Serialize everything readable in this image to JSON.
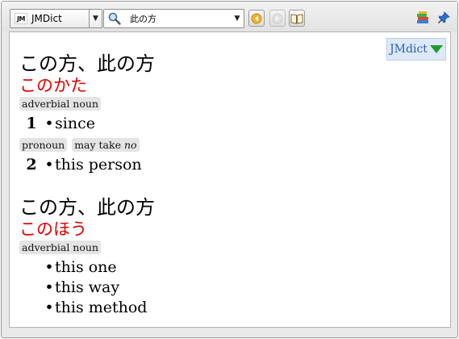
{
  "toolbar": {
    "dictionary": "JMDict",
    "search_value": "此の方",
    "logo_text": "JM"
  },
  "results": {
    "dict_badge": "JMdict",
    "entries": [
      {
        "headword": "この方、此の方",
        "reading": "このかた",
        "senses": [
          {
            "tags": [
              "adverbial noun"
            ],
            "num": "1",
            "gloss": "since"
          },
          {
            "tags": [
              "pronoun"
            ],
            "tag_prefix": "may take ",
            "tag_em": "no",
            "num": "2",
            "gloss": "this person"
          }
        ]
      },
      {
        "headword": "この方、此の方",
        "reading": "このほう",
        "tags": [
          "adverbial noun"
        ],
        "glosses": [
          "this one",
          "this way",
          "this method"
        ]
      }
    ]
  },
  "colors": {
    "reading": "#e00000",
    "badge_bg": "#dde9f7",
    "badge_text": "#2a5fb0",
    "badge_arrow": "#1f9a2f"
  }
}
